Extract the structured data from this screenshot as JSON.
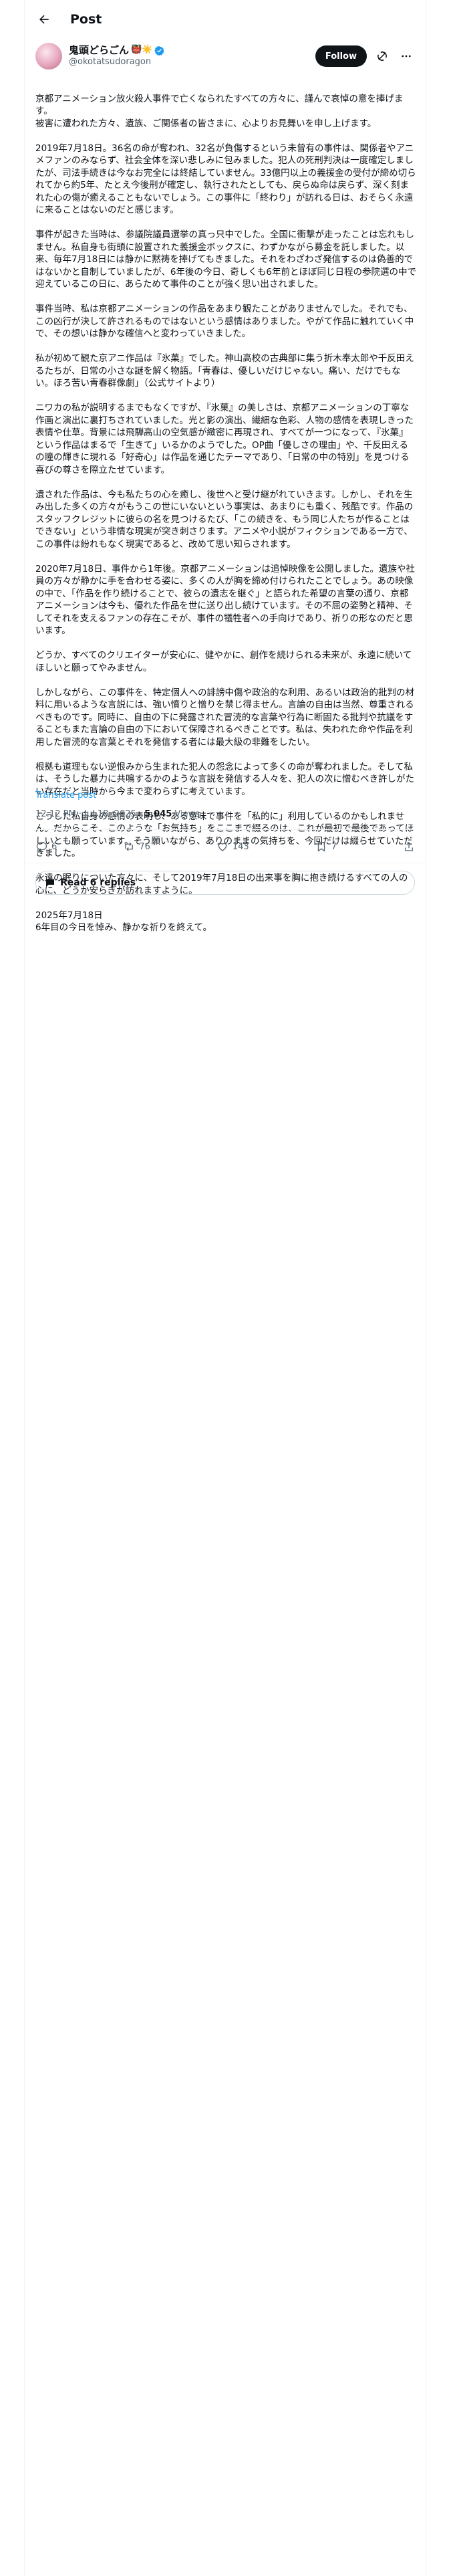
{
  "header": {
    "title": "Post"
  },
  "author": {
    "display_name": "鬼頭どらごん",
    "emoji": "👹☀️",
    "handle": "@okotatsudoragon",
    "verified_color": "#1d9bf0",
    "follow_label": "Follow"
  },
  "post": {
    "paragraphs": [
      "京都アニメーション放火殺人事件で亡くなられたすべての方々に、謹んで哀悼の意を捧げます。\n被害に遭われた方々、遺族、ご関係者の皆さまに、心よりお見舞いを申し上げます。",
      "2019年7月18日。36名の命が奪われ、32名が負傷するという未曾有の事件は、関係者やアニメファンのみならず、社会全体を深い悲しみに包みました。犯人の死刑判決は一度確定しましたが、司法手続きは今なお完全には終結していません。33億円以上の義援金の受付が締め切られてから約5年、たとえ今後刑が確定し、執行されたとしても、戻らぬ命は戻らず、深く刻まれた心の傷が癒えることもないでしょう。この事件に「終わり」が訪れる日は、おそらく永遠に来ることはないのだと感じます。",
      "事件が起きた当時は、参議院議員選挙の真っ只中でした。全国に衝撃が走ったことは忘れもしません。私自身も街頭に設置された義援金ボックスに、わずかながら募金を託しました。以来、毎年7月18日には静かに黙祷を捧げてもきました。それをわざわざ発信するのは偽善的ではないかと自制していましたが、6年後の今日、奇しくも6年前とほぼ同じ日程の参院選の中で迎えているこの日に、あらためて事件のことが強く思い出されました。",
      "事件当時、私は京都アニメーションの作品をあまり観たことがありませんでした。それでも、この凶行が決して許されるものではないという感情はありました。やがて作品に触れていく中で、その想いは静かな確信へと変わっていきました。",
      "私が初めて観た京アニ作品は『氷菓』でした。神山高校の古典部に集う折木奉太郎や千反田えるたちが、日常の小さな謎を解く物語。「青春は、優しいだけじゃない。痛い、だけでもない。ほろ苦い青春群像劇」（公式サイトより）",
      "ニワカの私が説明するまでもなくですが、『氷菓』の美しさは、京都アニメーションの丁寧な作画と演出に裏打ちされていました。光と影の演出、繊細な色彩、人物の感情を表現しきった表情や仕草。背景には飛騨高山の空気感が緻密に再現され、すべてが一つになって、『氷菓』という作品はまるで「生きて」いるかのようでした。OP曲「優しさの理由」や、千反田えるの瞳の輝きに現れる「好奇心」は作品を通じたテーマであり、「日常の中の特別」を見つける喜びの尊さを際立たせています。",
      "遺された作品は、今も私たちの心を癒し、後世へと受け継がれていきます。しかし、それを生み出した多くの方々がもうこの世にいないという事実は、あまりにも重く、残酷です。作品のスタッフクレジットに彼らの名を見つけるたび、「この続きを、もう同じ人たちが作ることはできない」という非情な現実が突き刺さります。アニメや小説がフィクションである一方で、この事件は紛れもなく現実であると、改めて思い知らされます。",
      "2020年7月18日、事件から1年後。京都アニメーションは追悼映像を公開しました。遺族や社員の方々が静かに手を合わせる姿に、多くの人が胸を締め付けられたことでしょう。あの映像の中で、「作品を作り続けることで、彼らの遺志を継ぐ」と語られた希望の言葉の通り、京都アニメーションは今も、優れた作品を世に送り出し続けています。その不屈の姿勢と精神、そしてそれを支えるファンの存在こそが、事件の犠牲者への手向けであり、祈りの形なのだと思います。",
      "どうか、すべてのクリエイターが安心に、健やかに、創作を続けられる未来が、永遠に続いてほしいと願ってやみません。",
      "しかしながら、この事件を、特定個人への誹謗中傷や政治的な利用、あるいは政治的批判の材料に用いるような言説には、強い憤りと憎りを禁じ得ません。言論の自由は当然、尊重されるべきものです。同時に、自由の下に発露された冒涜的な言葉や行為に断固たる批判や抗議をすることもまた言論の自由の下において保障されるべきことです。私は、失われた命や作品を利用した冒涜的な言葉とそれを発信する者には最大級の非難をしたい。",
      "根拠も道理もない逆恨みから生まれた犯人の怨念によって多くの命が奪われました。そして私は、そうした暴力に共鳴するかのような言説を発信する人々を、犯人の次に憎むべき許しがたい存在だと当時から今まで変わらずに考えています。",
      "こうした私自身の感情の表明も、ある意味で事件を「私的に」利用しているのかもしれません。だからこそ、このような「お気持ち」をここまで綴るのは、これが最初で最後であってほしいとも願っています。そう願いながら、ありのままの気持ちを、今回だけは綴らせていただきました。",
      "永遠の眠りについた方々に、そして2019年7月18日の出来事を胸に抱き続けるすべての人の心に、どうか安らぎが訪れますように。",
      "2025年7月18日\n6年目の今日を悼み、静かな祈りを終えて。"
    ],
    "translate_label": "Translate post",
    "time": "12:12 PM · Jul 18, 2025",
    "separator": " · ",
    "views_count": "5,045",
    "views_label": " Views"
  },
  "actions": {
    "replies": "6",
    "reposts": "76",
    "likes": "143",
    "bookmarks": "7"
  },
  "read_replies_label": "Read 6 replies"
}
